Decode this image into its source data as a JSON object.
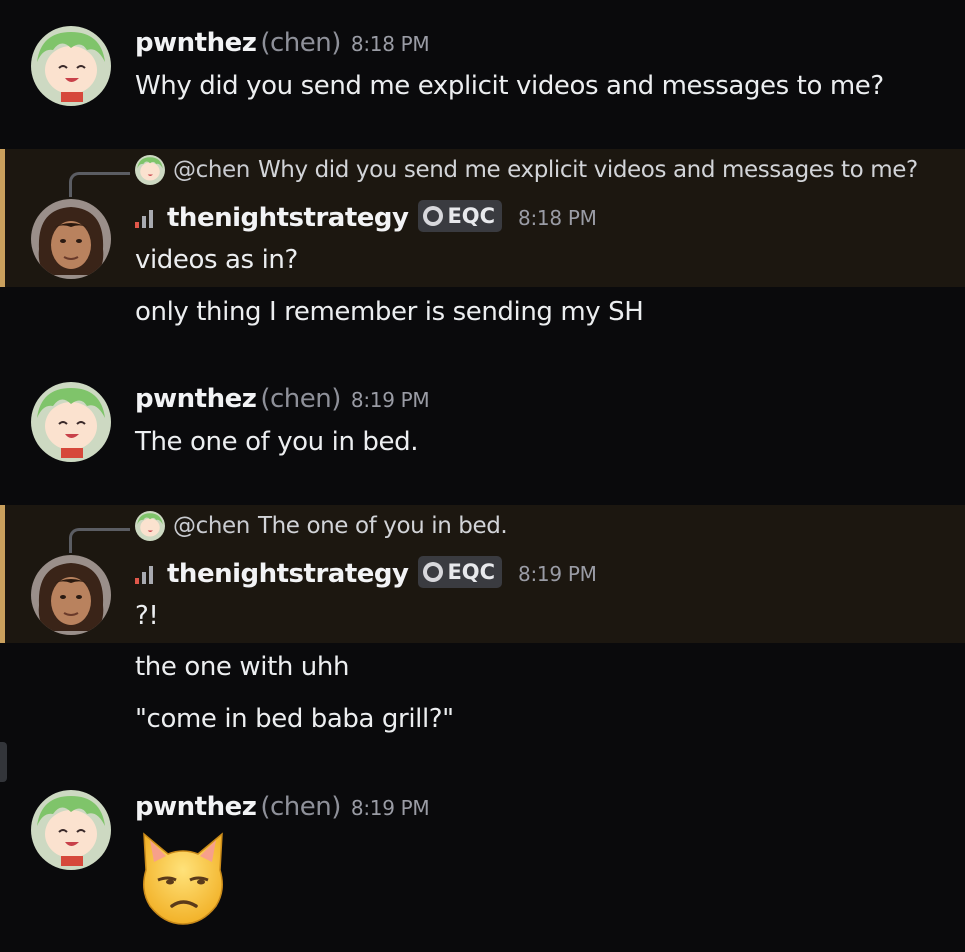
{
  "messages": [
    {
      "user": "pwnthez",
      "nick": "(chen)",
      "time": "8:18 PM",
      "lines": [
        "Why did you send me explicit videos and messages to me?"
      ]
    },
    {
      "reply": {
        "mention": "@chen",
        "text": "Why did you send me explicit videos and messages to me?"
      },
      "user": "thenightstrategy",
      "tag": "EQC",
      "time": "8:18 PM",
      "lines": [
        "videos as in?",
        "only thing I remember is sending my SH"
      ]
    },
    {
      "user": "pwnthez",
      "nick": "(chen)",
      "time": "8:19 PM",
      "lines": [
        "The one of you in bed."
      ]
    },
    {
      "reply": {
        "mention": "@chen",
        "text": "The one of you in bed."
      },
      "user": "thenightstrategy",
      "tag": "EQC",
      "time": "8:19 PM",
      "lines": [
        "?!",
        "the one with uhh",
        "\"come in bed baba grill?\""
      ]
    },
    {
      "user": "pwnthez",
      "nick": "(chen)",
      "time": "8:19 PM",
      "emoji": "unamused-cat-emoji"
    }
  ],
  "colors": {
    "background": "#0a0a0c",
    "highlight": "#1c1710",
    "highlight_bar": "#caa05d",
    "tag_bg": "#3a3b40"
  }
}
